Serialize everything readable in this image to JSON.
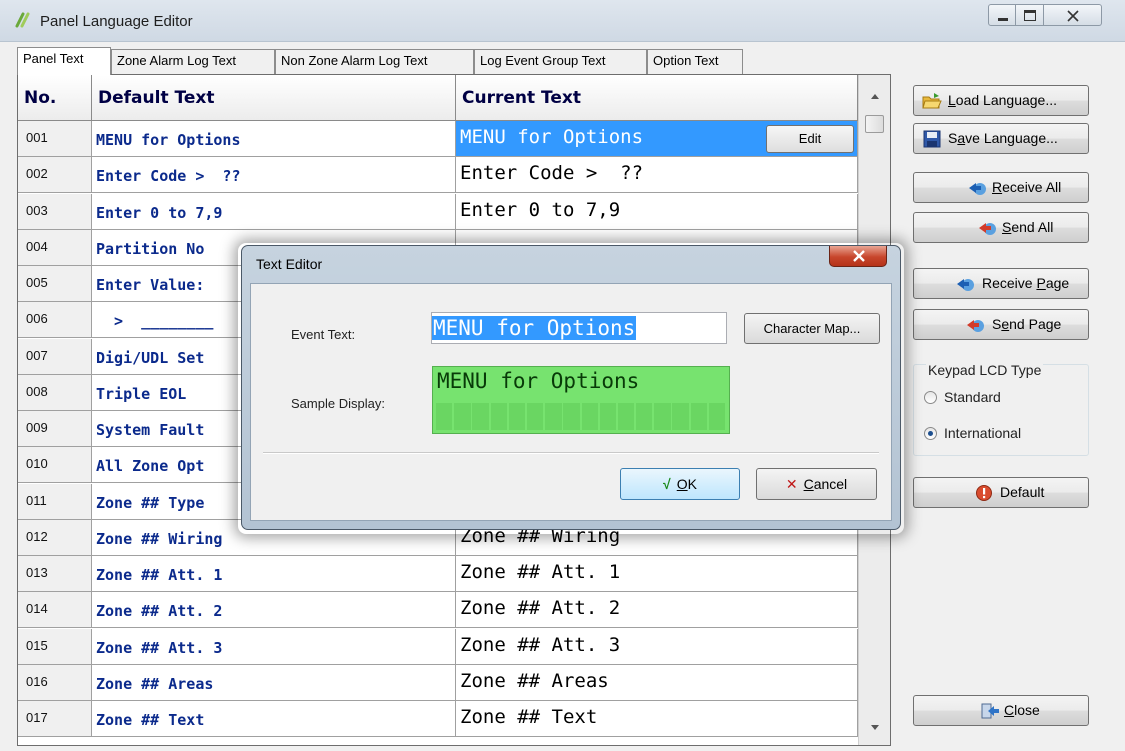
{
  "window": {
    "title": "Panel Language Editor"
  },
  "tabs": [
    "Panel Text",
    "Zone Alarm Log Text",
    "Non Zone Alarm Log Text",
    "Log Event Group Text",
    "Option Text"
  ],
  "grid": {
    "headers": {
      "no": "No.",
      "default": "Default Text",
      "current": "Current Text"
    },
    "edit_label": "Edit",
    "rows": [
      {
        "no": "001",
        "default": "MENU for Options",
        "current": "MENU for Options",
        "selected": true
      },
      {
        "no": "002",
        "default": "Enter Code >  ??",
        "current": "Enter Code >  ??"
      },
      {
        "no": "003",
        "default": "Enter 0 to 7,9",
        "current": "Enter 0 to 7,9"
      },
      {
        "no": "004",
        "default": "Partition No",
        "current": ""
      },
      {
        "no": "005",
        "default": "Enter Value:",
        "current": ""
      },
      {
        "no": "006",
        "default": "  >  ________",
        "current": ""
      },
      {
        "no": "007",
        "default": "Digi/UDL Set",
        "current": ""
      },
      {
        "no": "008",
        "default": "Triple EOL",
        "current": ""
      },
      {
        "no": "009",
        "default": "System Fault",
        "current": ""
      },
      {
        "no": "010",
        "default": "All Zone Opt",
        "current": ""
      },
      {
        "no": "011",
        "default": "Zone ## Type",
        "current": ""
      },
      {
        "no": "012",
        "default": "Zone ## Wiring",
        "current": "Zone ## Wiring"
      },
      {
        "no": "013",
        "default": "Zone ## Att. 1",
        "current": "Zone ## Att. 1"
      },
      {
        "no": "014",
        "default": "Zone ## Att. 2",
        "current": "Zone ## Att. 2"
      },
      {
        "no": "015",
        "default": "Zone ## Att. 3",
        "current": "Zone ## Att. 3"
      },
      {
        "no": "016",
        "default": "Zone ## Areas",
        "current": "Zone ## Areas"
      },
      {
        "no": "017",
        "default": "Zone ## Text",
        "current": "Zone ## Text"
      }
    ]
  },
  "right_panel": {
    "load_language": {
      "pre": "",
      "key": "L",
      "post": "oad Language..."
    },
    "save_language": {
      "pre": "S",
      "key": "a",
      "post": "ve Language..."
    },
    "receive_all": {
      "pre": "",
      "key": "R",
      "post": "eceive All"
    },
    "send_all": {
      "pre": "",
      "key": "S",
      "post": "end All"
    },
    "receive_page": {
      "pre": "Receive ",
      "key": "P",
      "post": "age"
    },
    "send_page": {
      "pre": "S",
      "key": "e",
      "post": "nd Page"
    },
    "keypad_group": "Keypad LCD Type",
    "radio_standard": "Standard",
    "radio_international": "International",
    "selected_lcd_type": "International",
    "default_label": "Default",
    "close": {
      "pre": "",
      "key": "C",
      "post": "lose"
    }
  },
  "dialog": {
    "title": "Text Editor",
    "event_text_label": "Event Text:",
    "event_text_value": "MENU for Options",
    "character_map_label": "Character Map...",
    "sample_display_label": "Sample Display:",
    "sample_line1": "MENU for Options",
    "ok": {
      "pre": "",
      "key": "O",
      "post": "K"
    },
    "cancel": {
      "pre": "",
      "key": "C",
      "post": "ancel"
    }
  },
  "colors": {
    "selection": "#3399ff",
    "lcd_green": "#77e36f",
    "default_text_blue": "#0b2a8c"
  }
}
